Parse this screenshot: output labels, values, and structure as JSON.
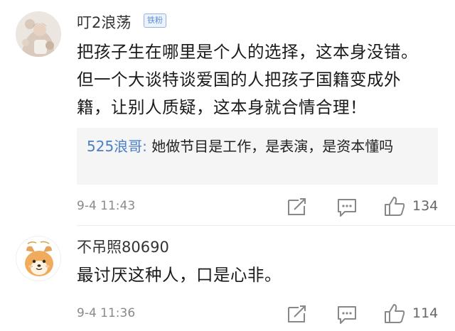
{
  "comments": [
    {
      "username": "叮2浪荡",
      "badge": "铁粉",
      "body": "把孩子生在哪里是个人的选择，这本身没错。但一个大谈特谈爱国的人把孩子国籍变成外籍，让别人质疑，这本身就合情合理！",
      "quote": {
        "author": "525浪哥:",
        "text": " 她做节目是工作，是表演，是资本懂吗"
      },
      "timestamp": "9-4 11:43",
      "likes": "134"
    },
    {
      "username": "不吊照80690",
      "body": "最讨厌这种人，口是心非。",
      "timestamp": "9-4 11:36",
      "likes": "114"
    }
  ],
  "icons": {
    "repost": "repost-icon",
    "comment": "comment-icon",
    "like": "like-icon"
  },
  "colors": {
    "quote_author": "#4a7fc6",
    "badge": "#5b8fd9",
    "timestamp": "#8a8a8a"
  }
}
